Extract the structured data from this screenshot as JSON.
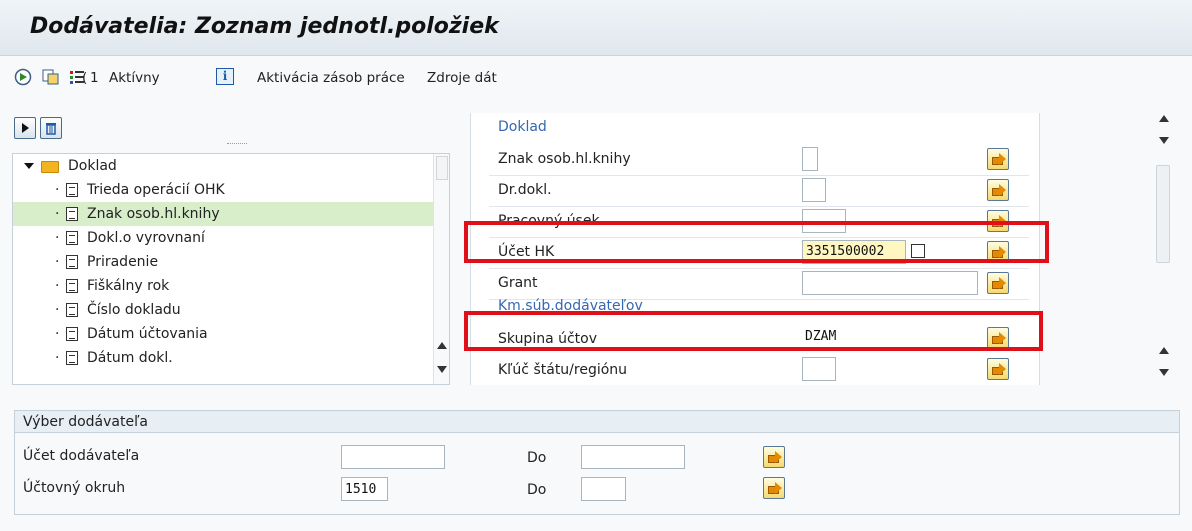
{
  "title": "Dodávatelia: Zoznam jednotl.položiek",
  "toolbar": {
    "layout_count": "1",
    "active_label": "Aktívny",
    "info_glyph": "i",
    "worklist_label": "Aktivácia zásob práce",
    "datasource_label": "Zdroje dát"
  },
  "tree": {
    "root_label": "Doklad",
    "items": [
      "Trieda operácií OHK",
      "Znak osob.hl.knihy",
      "Dokl.o vyrovnaní",
      "Priradenie",
      "Fiškálny rok",
      "Číslo dokladu",
      "Dátum účtovania",
      "Dátum dokl."
    ],
    "selected_index": 1
  },
  "form": {
    "group1_title": "Doklad",
    "fields": [
      {
        "label": "Znak osob.hl.knihy",
        "value": ""
      },
      {
        "label": "Dr.dokl.",
        "value": ""
      },
      {
        "label": "Pracovný úsek",
        "value": ""
      },
      {
        "label": "Účet HK",
        "value": "3351500002"
      },
      {
        "label": "Grant",
        "value": ""
      }
    ],
    "group2_title": "Km.súb.dodávateľov",
    "fields2": [
      {
        "label": "Skupina účtov",
        "value": "DZAM"
      },
      {
        "label": "Kľúč štátu/regiónu",
        "value": ""
      }
    ]
  },
  "vendor_selection": {
    "header": "Výber dodávateľa",
    "rows": [
      {
        "label": "Účet dodávateľa",
        "from": "",
        "to_label": "Do",
        "to": ""
      },
      {
        "label": "Účtovný okruh",
        "from": "1510",
        "to_label": "Do",
        "to": ""
      }
    ]
  },
  "colors": {
    "highlight_box": "#e0101a",
    "group_title": "#3468b2",
    "selected_row": "#d8eecb"
  }
}
